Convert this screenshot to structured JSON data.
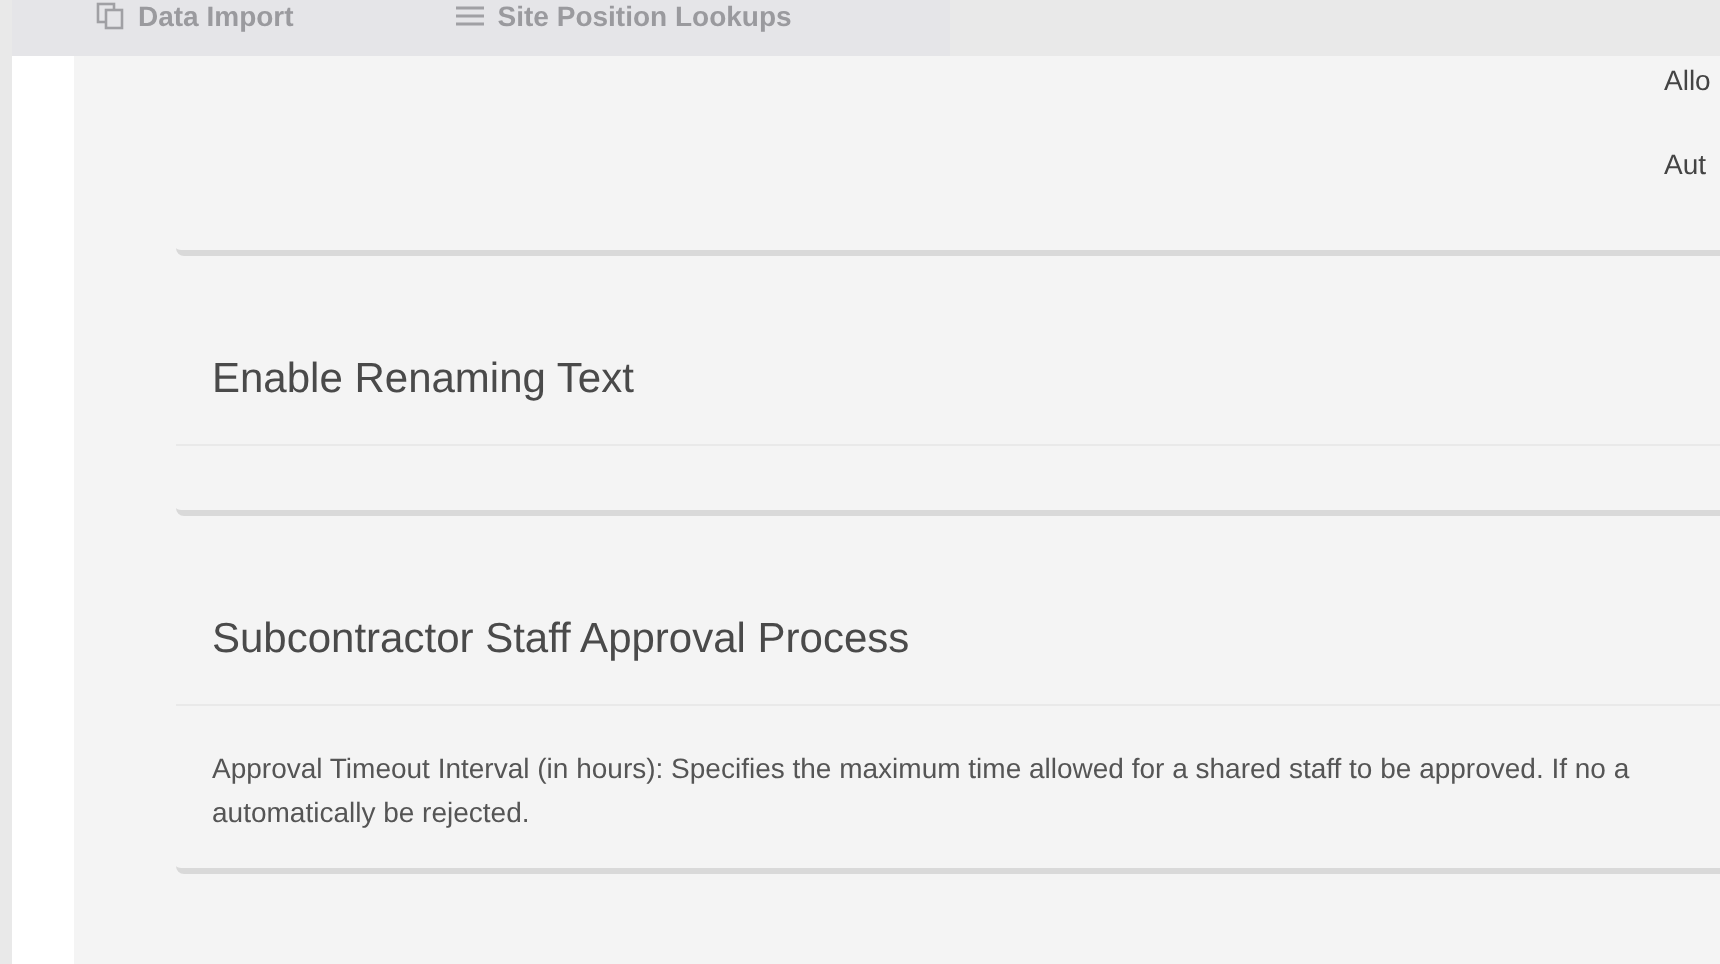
{
  "tabs": [
    {
      "label": "Data Import"
    },
    {
      "label": "Site Position Lookups"
    }
  ],
  "cards": [
    {
      "lines": [
        "Allo",
        "Aut"
      ]
    },
    {
      "title": "Enable Renaming Text"
    },
    {
      "title": "Subcontractor Staff Approval Process",
      "description": "Approval Timeout Interval (in hours): Specifies the maximum time allowed for a shared staff to be approved. If no a\nautomatically be rejected."
    }
  ]
}
